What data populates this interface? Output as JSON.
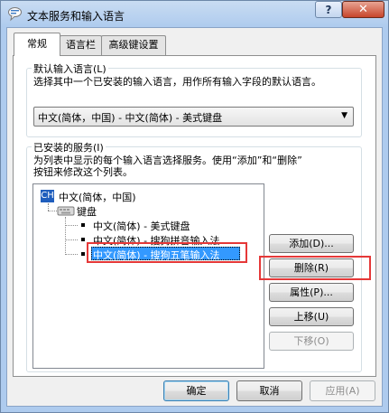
{
  "window": {
    "title": "文本服务和输入语言",
    "help_label": "?",
    "close_label": "✕",
    "icon": "speech-bubble-icon"
  },
  "tabs": [
    {
      "label": "常规",
      "active": true
    },
    {
      "label": "语言栏",
      "active": false
    },
    {
      "label": "高级键设置",
      "active": false
    }
  ],
  "default_language": {
    "group_label": "默认输入语言(L)",
    "description": "选择其中一个已安装的输入语言，用作所有输入字段的默认语言。",
    "selected": "中文(简体，中国) - 中文(简体) - 美式键盘"
  },
  "installed_services": {
    "group_label": "已安装的服务(I)",
    "description_line1": "为列表中显示的每个输入语言选择服务。使用“添加”和“删除”",
    "description_line2": "按钮来修改这个列表。",
    "tree": {
      "language_code": "CH",
      "language": "中文(简体，中国)",
      "category": "键盘",
      "category_icon": "keyboard-icon",
      "items": [
        {
          "label": "中文(简体) - 美式键盘",
          "selected": false
        },
        {
          "label": "中文(简体) - 搜狗拼音输入法",
          "selected": false
        },
        {
          "label": "中文(简体) - 搜狗五笔输入法",
          "selected": true
        }
      ]
    },
    "buttons": {
      "add": "添加(D)...",
      "remove": "删除(R)",
      "properties": "属性(P)...",
      "move_up": "上移(U)",
      "move_down": "下移(O)"
    }
  },
  "footer": {
    "ok": "确定",
    "cancel": "取消",
    "apply": "应用(A)"
  },
  "colors": {
    "selection": "#3399ff",
    "highlight_box": "#e53838"
  }
}
